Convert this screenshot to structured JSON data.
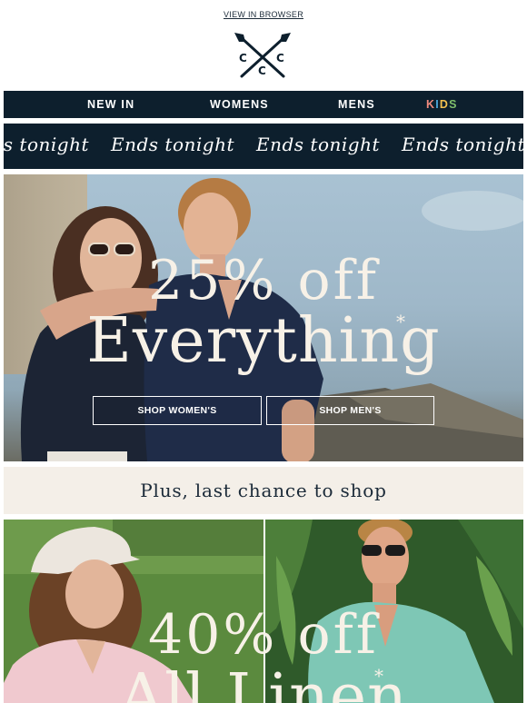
{
  "header": {
    "view_in_browser": "VIEW IN BROWSER",
    "logo_letters": [
      "C",
      "C",
      "C"
    ]
  },
  "nav": {
    "items": [
      {
        "label": "NEW IN"
      },
      {
        "label": "WOMENS"
      },
      {
        "label": "MENS"
      }
    ],
    "kids_letters": [
      "K",
      "I",
      "D",
      "S"
    ],
    "kids_colors": [
      "#f08a7e",
      "#4aa6dc",
      "#f3c14f",
      "#7fbf6b"
    ]
  },
  "ticker": {
    "items": [
      "Ends tonight",
      "Ends tonight",
      "Ends tonight",
      "Ends tonight"
    ]
  },
  "hero_sale": {
    "line1": "25% off",
    "line2": "Everything",
    "asterisk": "*",
    "shop_women_label": "SHOP WOMEN'S",
    "shop_men_label": "SHOP MEN'S"
  },
  "banner": {
    "text": "Plus, last chance to shop"
  },
  "hero_linen": {
    "line1": "40% off",
    "line2": "All Linen",
    "asterisk": "*"
  },
  "colors": {
    "navy": "#0d1f2d",
    "cream": "#f4efe8",
    "hero_text": "#f7f1e7"
  }
}
